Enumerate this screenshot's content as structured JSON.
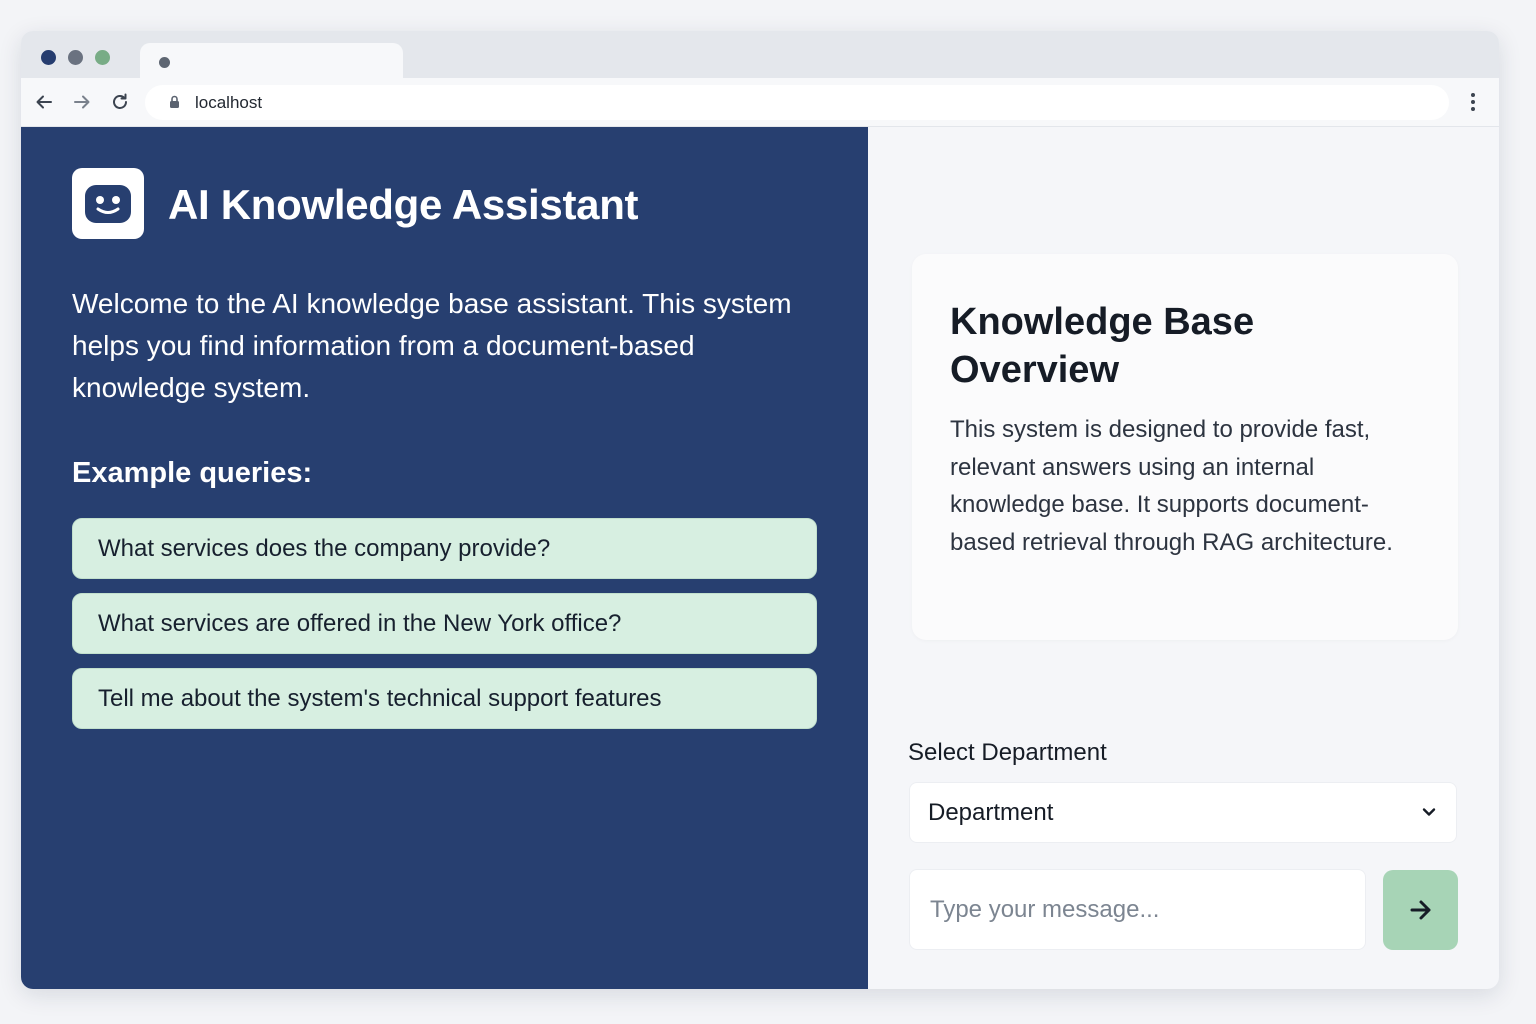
{
  "browser": {
    "url": "localhost",
    "icons": {
      "back": "arrow-left-icon",
      "forward": "arrow-right-icon",
      "reload": "reload-icon",
      "lock": "lock-icon",
      "menu": "kebab-menu-icon"
    }
  },
  "sidebar": {
    "logo_icon": "robot-face-icon",
    "title": "AI Knowledge Assistant",
    "welcome": "Welcome to the AI knowledge base assistant. This system helps you find information from a document-based knowledge system.",
    "examples_heading": "Example queries:",
    "queries": [
      {
        "label": "What services does  the company provide?"
      },
      {
        "label": "What services are offered in the New York office?"
      },
      {
        "label": "Tell me about the system's technical support features"
      }
    ]
  },
  "overview": {
    "title": "Knowledge Base Overview",
    "body": "This system is designed to provide fast, relevant answers using an internal knowledge base. It supports document-based retrieval through RAG architecture."
  },
  "chat": {
    "department_label": "Select Department",
    "department_value": "Department",
    "message_placeholder": "Type your message...",
    "send_icon": "arrow-right-icon"
  },
  "colors": {
    "sidebar_bg": "#273f70",
    "query_bg": "#d7efe1",
    "send_bg": "#a7d4b6",
    "page_bg": "#f5f6f9"
  }
}
